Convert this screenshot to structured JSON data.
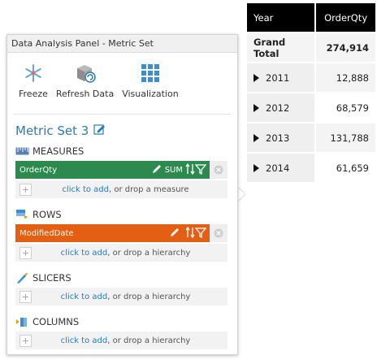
{
  "table": {
    "headers": {
      "year": "Year",
      "value": "OrderQty"
    },
    "total": {
      "label": "Grand Total",
      "value": "274,914"
    },
    "rows": [
      {
        "year": "2011",
        "value": "12,888"
      },
      {
        "year": "2012",
        "value": "68,579"
      },
      {
        "year": "2013",
        "value": "131,788"
      },
      {
        "year": "2014",
        "value": "61,659"
      }
    ]
  },
  "panel": {
    "title": "Data Analysis Panel - Metric Set",
    "toolbar": {
      "freeze": "Freeze",
      "refresh": "Refresh Data",
      "visualization": "Visualization"
    },
    "metric_set_name": "Metric Set 3",
    "measures": {
      "heading": "MEASURES",
      "item": {
        "label": "OrderQty",
        "aggregation": "SUM"
      },
      "drop": {
        "link": "click to add",
        "rest": ", or drop a measure"
      }
    },
    "rows": {
      "heading": "ROWS",
      "item": {
        "label": "ModifiedDate"
      },
      "drop": {
        "link": "click to add",
        "rest": ", or drop a hierarchy"
      }
    },
    "slicers": {
      "heading": "SLICERS",
      "drop": {
        "link": "click to add",
        "rest": ", or drop a hierarchy"
      }
    },
    "columns": {
      "heading": "COLUMNS",
      "drop": {
        "link": "click to add",
        "rest": ", or drop a hierarchy"
      }
    }
  },
  "colors": {
    "measure_chip": "#2d8a4e",
    "row_chip": "#e35f13",
    "accent": "#2a7ab8"
  },
  "icons": {
    "freeze": "snowflake-icon",
    "refresh": "refresh-data-icon",
    "visualization": "grid-icon",
    "edit": "pencil-icon",
    "measures": "ruler-icon",
    "rows": "rows-icon",
    "slicers": "knife-icon",
    "columns": "columns-icon"
  }
}
